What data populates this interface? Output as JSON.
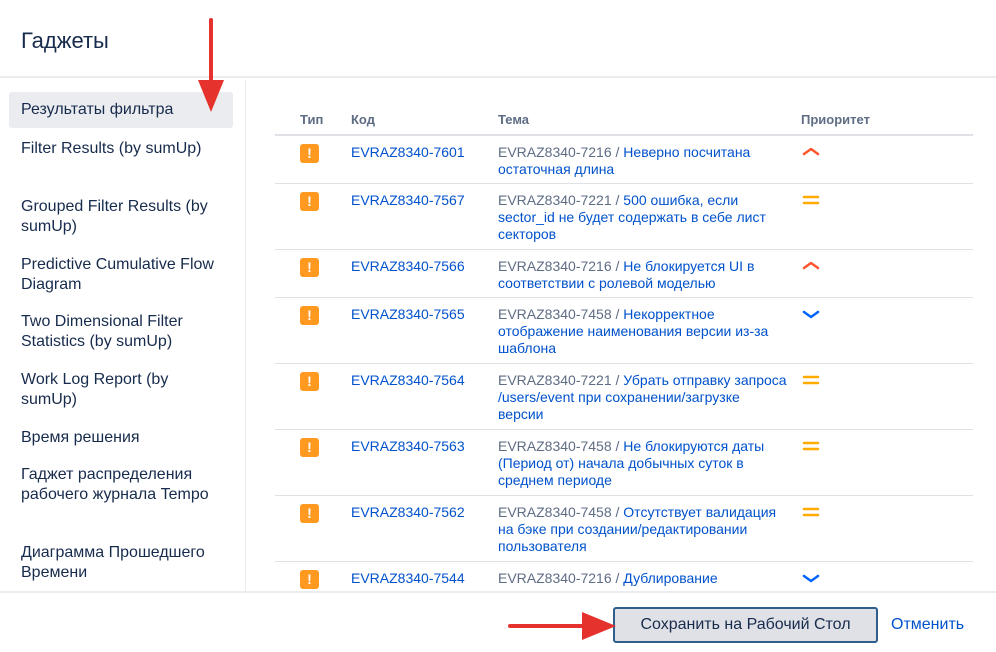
{
  "dialog": {
    "title": "Гаджеты"
  },
  "sidebar": {
    "items": [
      {
        "label": "Результаты фильтра",
        "active": true
      },
      {
        "label": "Filter Results (by sumUp)"
      },
      {
        "label": "Grouped Filter Results (by sumUp)"
      },
      {
        "label": "Predictive Cumulative Flow Diagram"
      },
      {
        "label": "Two Dimensional Filter Statistics (by sumUp)"
      },
      {
        "label": "Work Log Report (by sumUp)"
      },
      {
        "label": "Время решения"
      },
      {
        "label": "Гаджет распределения рабочего журнала Tempo"
      },
      {
        "label": "Диаграмма Прошедшего Времени"
      }
    ]
  },
  "table": {
    "columns": {
      "type": "Тип",
      "key": "Код",
      "summary": "Тема",
      "priority": "Приоритет"
    },
    "rows": [
      {
        "key": "EVRAZ8340-7601",
        "parent": "EVRAZ8340-7216 /",
        "summary": "Неверно посчитана остаточная длина",
        "priority": "high"
      },
      {
        "key": "EVRAZ8340-7567",
        "parent": "EVRAZ8340-7221 /",
        "summary": "500 ошибка, если sector_id не будет содержать в себе лист секторов",
        "priority": "medium"
      },
      {
        "key": "EVRAZ8340-7566",
        "parent": "EVRAZ8340-7216 /",
        "summary": "Не блокируется UI в соответствии с ролевой моделью",
        "priority": "high"
      },
      {
        "key": "EVRAZ8340-7565",
        "parent": "EVRAZ8340-7458 /",
        "summary": "Некорректное отображение наименования версии из-за шаблона",
        "priority": "low"
      },
      {
        "key": "EVRAZ8340-7564",
        "parent": "EVRAZ8340-7221 /",
        "summary": "Убрать отправку запроса /users/event при сохранении/загрузке версии",
        "priority": "medium"
      },
      {
        "key": "EVRAZ8340-7563",
        "parent": "EVRAZ8340-7458 /",
        "summary": "Не блокируются даты (Период от) начала добычных суток в среднем периоде",
        "priority": "medium"
      },
      {
        "key": "EVRAZ8340-7562",
        "parent": "EVRAZ8340-7458 /",
        "summary": "Отсутствует валидация на бэке при создании/редактировании пользователя",
        "priority": "medium"
      },
      {
        "key": "EVRAZ8340-7544",
        "parent": "EVRAZ8340-7216 /",
        "summary": "Дублирование",
        "priority": "low"
      }
    ]
  },
  "footer": {
    "save_label": "Сохранить на Рабочий Стол",
    "cancel_label": "Отменить"
  },
  "colors": {
    "accent": "#0052cc",
    "bug_icon": "#ff991f",
    "priority_high": "#ff5630",
    "priority_medium": "#ffab00",
    "priority_low": "#0065ff",
    "annotation_arrow": "#e5322d"
  }
}
